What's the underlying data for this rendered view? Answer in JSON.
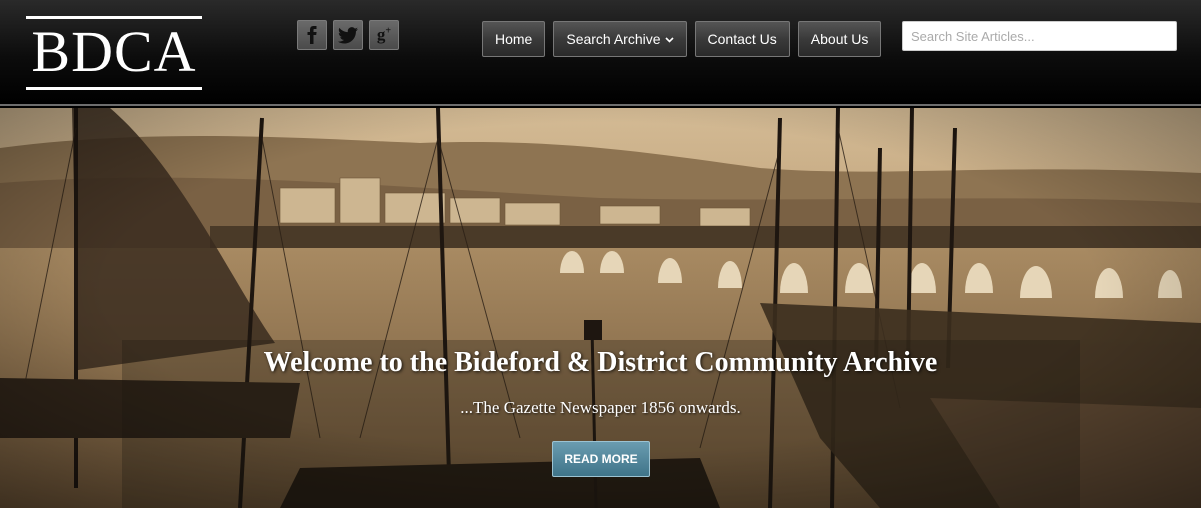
{
  "logo": {
    "text": "BDCA"
  },
  "social": [
    {
      "icon": "facebook-icon",
      "glyph": "f"
    },
    {
      "icon": "twitter-icon",
      "glyph": "t"
    },
    {
      "icon": "google-plus-icon",
      "glyph": "g+"
    }
  ],
  "nav": {
    "home": "Home",
    "search_archive": "Search Archive",
    "contact": "Contact Us",
    "about": "About Us"
  },
  "search": {
    "placeholder": "Search Site Articles..."
  },
  "hero": {
    "title": "Welcome to the Bideford & District Community Archive",
    "subtitle": "...The Gazette Newspaper 1856 onwards.",
    "button": "READ MORE"
  },
  "colors": {
    "header_bg": "#000000",
    "accent_button": "#4f879c",
    "sepia": "#b89a70"
  }
}
